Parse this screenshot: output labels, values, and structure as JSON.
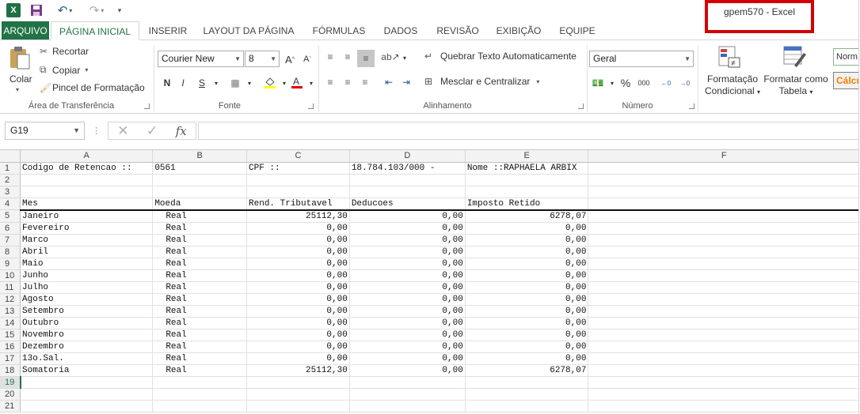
{
  "window": {
    "title": "gpem570 - Excel"
  },
  "qat": {
    "app_icon": "X",
    "save_icon": "save-icon",
    "undo_icon": "undo-icon",
    "redo_icon": "redo-icon"
  },
  "tabs": [
    {
      "label": "ARQUIVO"
    },
    {
      "label": "PÁGINA INICIAL"
    },
    {
      "label": "INSERIR"
    },
    {
      "label": "LAYOUT DA PÁGINA"
    },
    {
      "label": "FÓRMULAS"
    },
    {
      "label": "DADOS"
    },
    {
      "label": "REVISÃO"
    },
    {
      "label": "EXIBIÇÃO"
    },
    {
      "label": "EQUIPE"
    }
  ],
  "ribbon": {
    "clipboard": {
      "paste": "Colar",
      "cut": "Recortar",
      "copy": "Copiar",
      "format_painter": "Pincel de Formatação",
      "group": "Área de Transferência"
    },
    "font": {
      "name": "Courier New",
      "size": "8",
      "bold": "N",
      "italic": "I",
      "underline": "S",
      "group": "Fonte"
    },
    "alignment": {
      "wrap": "Quebrar Texto Automaticamente",
      "merge": "Mesclar e Centralizar",
      "group": "Alinhamento"
    },
    "number": {
      "format": "Geral",
      "percent": "%",
      "thousands": "000",
      "group": "Número"
    },
    "styles": {
      "cond_format": "Formatação",
      "cond_format2": "Condicional",
      "format_table": "Formatar como",
      "format_table2": "Tabela",
      "normal": "Norm",
      "calc": "Cálcu"
    }
  },
  "formula_bar": {
    "name_box": "G19",
    "formula": ""
  },
  "grid": {
    "columns": [
      "A",
      "B",
      "C",
      "D",
      "E",
      "F"
    ],
    "rows": [
      [
        "1",
        "Codigo de Retencao ::",
        "0561",
        "CPF ::",
        "18.784.103/000 -",
        "Nome ::RAPHAELA ARBIX",
        ""
      ],
      [
        "2",
        "",
        "",
        "",
        "",
        "",
        ""
      ],
      [
        "3",
        "",
        "",
        "",
        "",
        "",
        ""
      ],
      [
        "4",
        "Mes",
        "Moeda",
        "Rend. Tributavel",
        "Deducoes",
        "Imposto Retido",
        ""
      ],
      [
        "5",
        "Janeiro",
        "Real",
        "25112,30",
        "0,00",
        "6278,07",
        ""
      ],
      [
        "6",
        "Fevereiro",
        "Real",
        "0,00",
        "0,00",
        "0,00",
        ""
      ],
      [
        "7",
        "Marco",
        "Real",
        "0,00",
        "0,00",
        "0,00",
        ""
      ],
      [
        "8",
        "Abril",
        "Real",
        "0,00",
        "0,00",
        "0,00",
        ""
      ],
      [
        "9",
        "Maio",
        "Real",
        "0,00",
        "0,00",
        "0,00",
        ""
      ],
      [
        "10",
        "Junho",
        "Real",
        "0,00",
        "0,00",
        "0,00",
        ""
      ],
      [
        "11",
        "Julho",
        "Real",
        "0,00",
        "0,00",
        "0,00",
        ""
      ],
      [
        "12",
        "Agosto",
        "Real",
        "0,00",
        "0,00",
        "0,00",
        ""
      ],
      [
        "13",
        "Setembro",
        "Real",
        "0,00",
        "0,00",
        "0,00",
        ""
      ],
      [
        "14",
        "Outubro",
        "Real",
        "0,00",
        "0,00",
        "0,00",
        ""
      ],
      [
        "15",
        "Novembro",
        "Real",
        "0,00",
        "0,00",
        "0,00",
        ""
      ],
      [
        "16",
        "Dezembro",
        "Real",
        "0,00",
        "0,00",
        "0,00",
        ""
      ],
      [
        "17",
        "13o.Sal.",
        "Real",
        "0,00",
        "0,00",
        "0,00",
        ""
      ],
      [
        "18",
        "Somatoria",
        "Real",
        "25112,30",
        "0,00",
        "6278,07",
        ""
      ],
      [
        "19",
        "",
        "",
        "",
        "",
        "",
        ""
      ],
      [
        "20",
        "",
        "",
        "",
        "",
        "",
        ""
      ],
      [
        "21",
        "",
        "",
        "",
        "",
        "",
        ""
      ]
    ]
  },
  "colors": {
    "accent": "#217346",
    "highlight_border": "#d40000"
  }
}
